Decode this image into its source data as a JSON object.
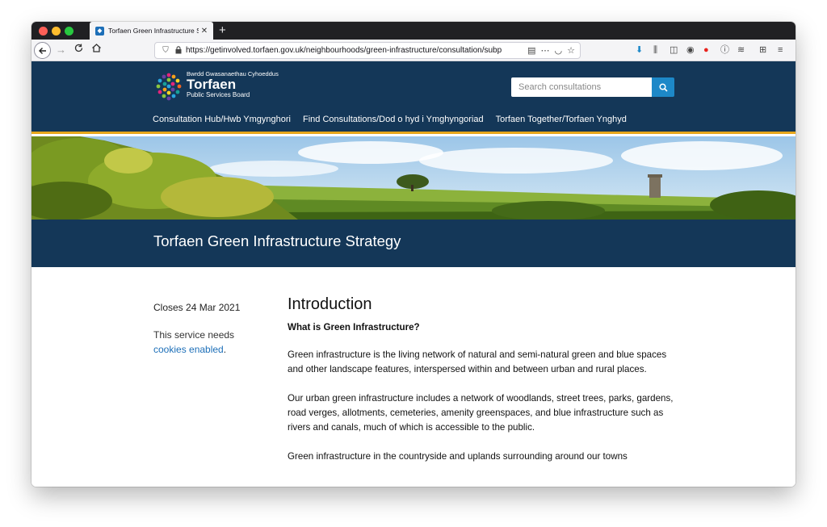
{
  "browser": {
    "tab_title": "Torfaen Green Infrastructure St",
    "url": "https://getinvolved.torfaen.gov.uk/neighbourhoods/green-infrastructure/consultation/subp"
  },
  "site": {
    "logo_top": "Bwrdd Gwasanaethau Cyhoeddus",
    "logo_main": "Torfaen",
    "logo_sub": "Public Services Board",
    "search_placeholder": "Search consultations",
    "nav": [
      {
        "label": "Consultation Hub/Hwb Ymgynghori"
      },
      {
        "label": "Find Consultations/Dod o hyd i Ymghyngoriad"
      },
      {
        "label": "Torfaen Together/Torfaen Ynghyd"
      }
    ]
  },
  "page": {
    "title": "Torfaen Green Infrastructure Strategy",
    "closes": "Closes 24 Mar 2021",
    "service_text": "This service needs",
    "cookies_link": "cookies enabled",
    "cookies_suffix": ".",
    "heading": "Introduction",
    "subheading": "What is Green Infrastructure?",
    "paragraphs": [
      "Green infrastructure is the living network of natural and semi-natural green and blue spaces and other landscape features, interspersed within and between urban and rural places.",
      "Our urban green infrastructure includes a network of woodlands, street trees, parks, gardens, road verges, allotments, cemeteries, amenity greenspaces, and blue infrastructure such as rivers and canals, much of which is accessible to the public.",
      "Green infrastructure in the countryside and uplands surrounding around our towns"
    ]
  },
  "colors": {
    "header_bg": "#143758",
    "accent_gold": "#e7a71c",
    "search_button": "#1d88c8",
    "link": "#1d6fb8"
  }
}
